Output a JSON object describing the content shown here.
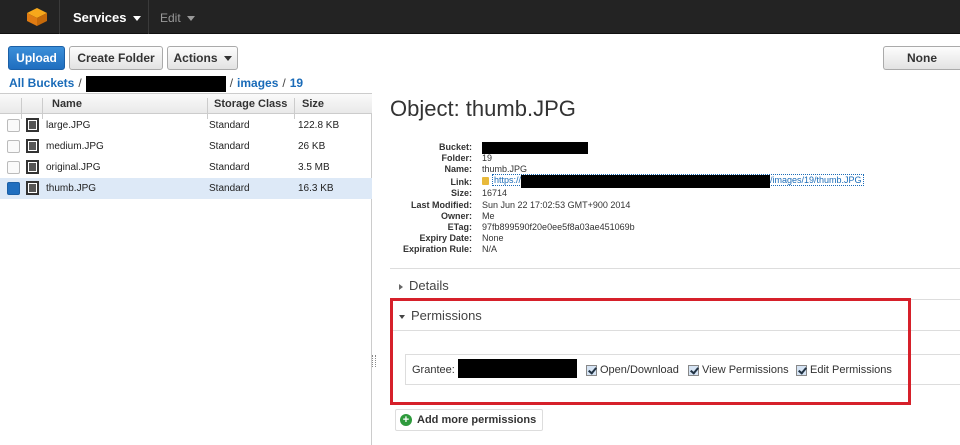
{
  "topbar": {
    "services_label": "Services",
    "edit_label": "Edit"
  },
  "toolbar": {
    "upload_label": "Upload",
    "create_folder_label": "Create Folder",
    "actions_label": "Actions",
    "none_label": "None"
  },
  "breadcrumb": {
    "all_buckets": "All Buckets",
    "separator": "/",
    "folder_images": "images",
    "folder_19": "19"
  },
  "file_list": {
    "columns": [
      "Name",
      "Storage Class",
      "Size"
    ],
    "rows": [
      {
        "name": "large.JPG",
        "storage_class": "Standard",
        "size": "122.8 KB",
        "selected": false
      },
      {
        "name": "medium.JPG",
        "storage_class": "Standard",
        "size": "26 KB",
        "selected": false
      },
      {
        "name": "original.JPG",
        "storage_class": "Standard",
        "size": "3.5 MB",
        "selected": false
      },
      {
        "name": "thumb.JPG",
        "storage_class": "Standard",
        "size": "16.3 KB",
        "selected": true
      }
    ]
  },
  "object": {
    "title": "Object: thumb.JPG",
    "properties": [
      {
        "key": "Bucket:",
        "value": ""
      },
      {
        "key": "Folder:",
        "value": "19"
      },
      {
        "key": "Name:",
        "value": "thumb.JPG"
      },
      {
        "key": "Link:",
        "value": "/images/19/thumb.JPG",
        "link_prefix": "https://"
      },
      {
        "key": "Size:",
        "value": "16714"
      },
      {
        "key": "Last Modified:",
        "value": "Sun Jun 22 17:02:53 GMT+900 2014"
      },
      {
        "key": "Owner:",
        "value": "Me"
      },
      {
        "key": "ETag:",
        "value": "97fb899590f20e0ee5f8a03ae451069b"
      },
      {
        "key": "Expiry Date:",
        "value": "None"
      },
      {
        "key": "Expiration Rule:",
        "value": "N/A"
      }
    ]
  },
  "sections": {
    "details_label": "Details",
    "permissions_label": "Permissions"
  },
  "permissions": {
    "grantee_label": "Grantee:",
    "open_download": "Open/Download",
    "view_permissions": "View Permissions",
    "edit_permissions": "Edit Permissions",
    "add_more": "Add more permissions"
  },
  "colors": {
    "topbar_bg": "#232323",
    "primary_button": "#1f6ebf",
    "link": "#1a6bb8",
    "highlight_box": "#d6202a",
    "selected_row": "#dde9f7"
  }
}
